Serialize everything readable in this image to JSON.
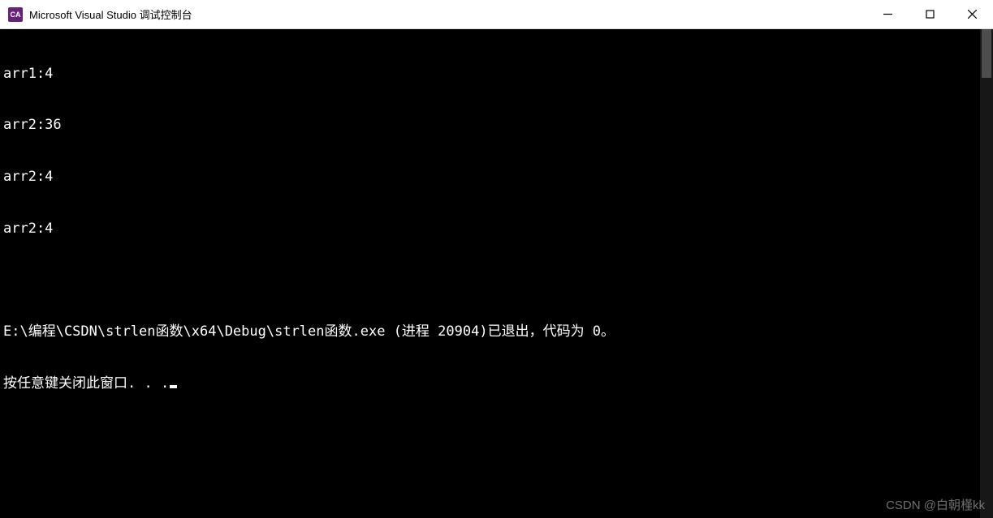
{
  "window": {
    "title": "Microsoft Visual Studio 调试控制台",
    "icon_label": "CA"
  },
  "console": {
    "lines": [
      "arr1:4",
      "arr2:36",
      "arr2:4",
      "arr2:4"
    ],
    "exit_message": "E:\\编程\\CSDN\\strlen函数\\x64\\Debug\\strlen函数.exe (进程 20904)已退出，代码为 0。",
    "prompt_message": "按任意键关闭此窗口. . ."
  },
  "watermark": "CSDN @白朝槿kk"
}
